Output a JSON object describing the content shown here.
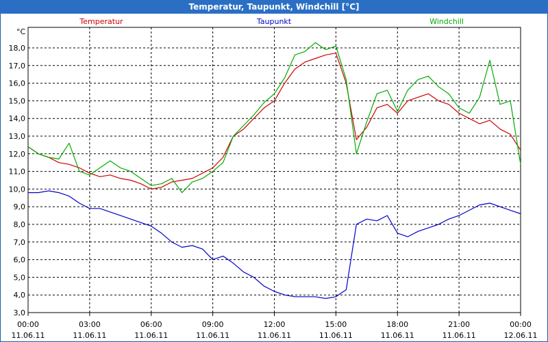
{
  "window": {
    "title": "Temperatur, Taupunkt, Windchill [°C]"
  },
  "colors": {
    "titlebar": "#2a6fc4",
    "temperature": "#cc0000",
    "dewpoint": "#0000cc",
    "windchill": "#00aa00"
  },
  "chart_data": {
    "type": "line",
    "title": "Temperatur, Taupunkt, Windchill [°C]",
    "ylabel": "°C",
    "ylim": [
      3.0,
      18.0
    ],
    "xlim": [
      0,
      24
    ],
    "grid": true,
    "legend_position": "top",
    "y_ticks": [
      "3,0",
      "4,0",
      "5,0",
      "6,0",
      "7,0",
      "8,0",
      "9,0",
      "10,0",
      "11,0",
      "12,0",
      "13,0",
      "14,0",
      "15,0",
      "16,0",
      "17,0",
      "18,0"
    ],
    "x_ticks": [
      {
        "time": "00:00",
        "date": "11.06.11"
      },
      {
        "time": "03:00",
        "date": "11.06.11"
      },
      {
        "time": "06:00",
        "date": "11.06.11"
      },
      {
        "time": "09:00",
        "date": "11.06.11"
      },
      {
        "time": "12:00",
        "date": "11.06.11"
      },
      {
        "time": "15:00",
        "date": "11.06.11"
      },
      {
        "time": "18:00",
        "date": "11.06.11"
      },
      {
        "time": "21:00",
        "date": "11.06.11"
      },
      {
        "time": "00:00",
        "date": "12.06.11"
      }
    ],
    "x_unit": "hours since 11.06.11 00:00",
    "series": [
      {
        "name": "Temperatur",
        "color": "#cc0000",
        "x": [
          0,
          0.5,
          1,
          1.5,
          2,
          2.5,
          3,
          3.5,
          4,
          4.5,
          5,
          5.5,
          6,
          6.5,
          7,
          7.5,
          8,
          8.5,
          9,
          9.5,
          10,
          10.5,
          11,
          11.5,
          12,
          12.5,
          13,
          13.5,
          14,
          14.5,
          15,
          15.5,
          16,
          16.5,
          17,
          17.5,
          18,
          18.5,
          19,
          19.5,
          20,
          20.5,
          21,
          21.5,
          22,
          22.5,
          23,
          23.5,
          24
        ],
        "values": [
          12.4,
          12.0,
          11.8,
          11.5,
          11.4,
          11.2,
          10.9,
          10.7,
          10.8,
          10.6,
          10.5,
          10.3,
          10.0,
          10.1,
          10.4,
          10.5,
          10.6,
          10.9,
          11.2,
          11.8,
          13.0,
          13.4,
          14.0,
          14.6,
          15.0,
          16.0,
          16.8,
          17.2,
          17.4,
          17.6,
          17.7,
          16.0,
          12.8,
          13.5,
          14.6,
          14.8,
          14.3,
          15.0,
          15.2,
          15.4,
          15.0,
          14.8,
          14.3,
          14.0,
          13.7,
          13.9,
          13.4,
          13.1,
          12.2
        ]
      },
      {
        "name": "Taupunkt",
        "color": "#0000cc",
        "x": [
          0,
          0.5,
          1,
          1.5,
          2,
          2.5,
          3,
          3.5,
          4,
          4.5,
          5,
          5.5,
          6,
          6.5,
          7,
          7.5,
          8,
          8.5,
          9,
          9.5,
          10,
          10.5,
          11,
          11.5,
          12,
          12.5,
          13,
          13.5,
          14,
          14.5,
          15,
          15.5,
          16,
          16.5,
          17,
          17.5,
          18,
          18.5,
          19,
          19.5,
          20,
          20.5,
          21,
          21.5,
          22,
          22.5,
          23,
          23.5,
          24
        ],
        "values": [
          9.8,
          9.8,
          9.9,
          9.8,
          9.6,
          9.2,
          8.9,
          8.9,
          8.7,
          8.5,
          8.3,
          8.1,
          7.9,
          7.5,
          7.0,
          6.7,
          6.8,
          6.6,
          6.0,
          6.2,
          5.8,
          5.3,
          5.0,
          4.5,
          4.2,
          4.0,
          3.9,
          3.9,
          3.9,
          3.8,
          3.9,
          4.3,
          8.0,
          8.3,
          8.2,
          8.5,
          7.5,
          7.3,
          7.6,
          7.8,
          8.0,
          8.3,
          8.5,
          8.8,
          9.1,
          9.2,
          9.0,
          8.8,
          8.6
        ]
      },
      {
        "name": "Windchill",
        "color": "#00aa00",
        "x": [
          0,
          0.5,
          1,
          1.5,
          2,
          2.5,
          3,
          3.5,
          4,
          4.5,
          5,
          5.5,
          6,
          6.5,
          7,
          7.5,
          8,
          8.5,
          9,
          9.5,
          10,
          10.5,
          11,
          11.5,
          12,
          12.5,
          13,
          13.5,
          14,
          14.5,
          15,
          15.5,
          16,
          16.5,
          17,
          17.5,
          18,
          18.5,
          19,
          19.5,
          20,
          20.5,
          21,
          21.5,
          22,
          22.5,
          23,
          23.5,
          24
        ],
        "values": [
          12.4,
          12.0,
          11.8,
          11.7,
          12.6,
          11.0,
          10.8,
          11.2,
          11.6,
          11.2,
          11.0,
          10.6,
          10.2,
          10.3,
          10.6,
          9.8,
          10.4,
          10.6,
          11.0,
          11.5,
          13.0,
          13.6,
          14.2,
          14.9,
          15.4,
          16.3,
          17.6,
          17.8,
          18.3,
          17.9,
          18.1,
          16.2,
          12.0,
          13.8,
          15.4,
          15.6,
          14.4,
          15.6,
          16.2,
          16.4,
          15.8,
          15.4,
          14.6,
          14.3,
          15.2,
          17.3,
          14.8,
          15.0,
          11.4
        ]
      }
    ]
  }
}
